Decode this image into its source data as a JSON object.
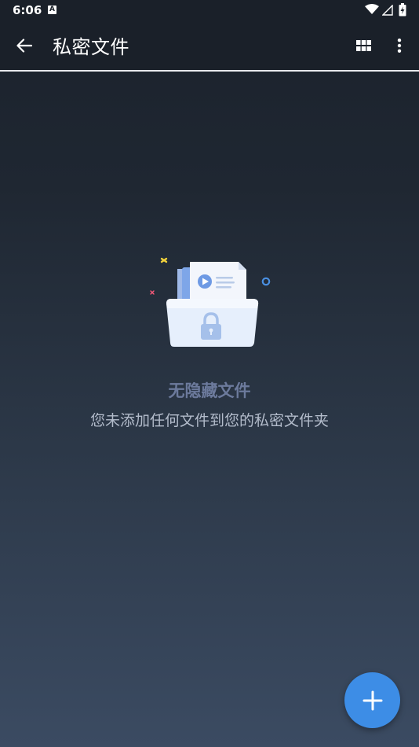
{
  "status_bar": {
    "time": "6:06",
    "notification_icon": "app-notification-icon",
    "notification_letter": "A",
    "icons": [
      "wifi-icon",
      "signal-icon",
      "battery-charging-icon"
    ]
  },
  "app_bar": {
    "title": "私密文件",
    "back_icon": "arrow-left-icon",
    "actions": [
      "grid-view-icon",
      "more-vert-icon"
    ]
  },
  "empty_state": {
    "illustration": "locked-folder-icon",
    "title": "无隐藏文件",
    "subtitle": "您未添加任何文件到您的私密文件夹"
  },
  "fab": {
    "icon": "plus-icon"
  },
  "colors": {
    "toolbar": "#1a2029",
    "fab": "#3d8de6",
    "empty_title": "#6c7a9c",
    "empty_subtitle": "#b3bccb"
  }
}
